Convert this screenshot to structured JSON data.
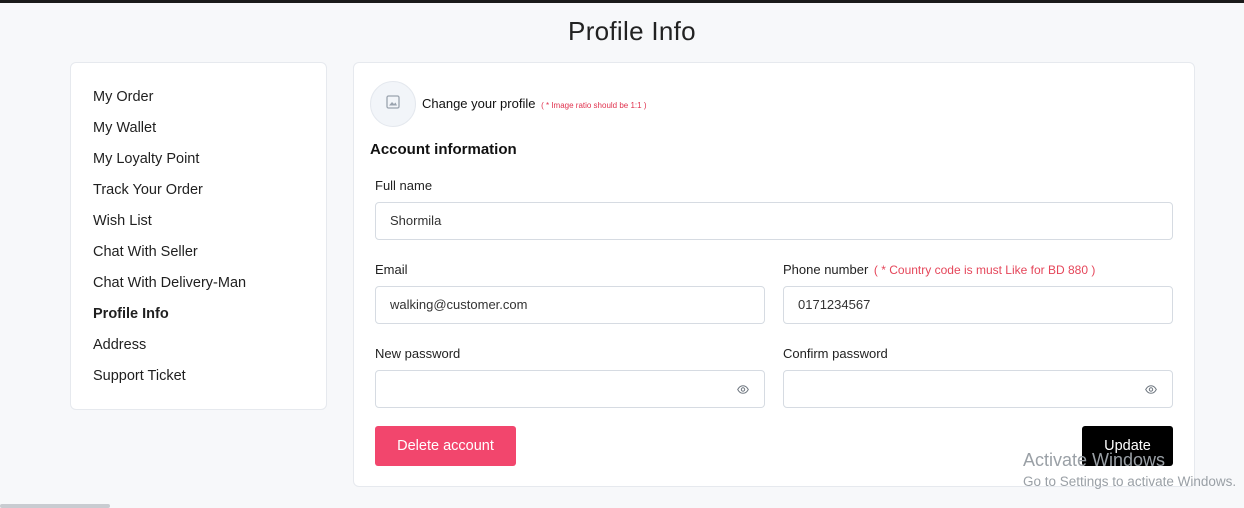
{
  "page": {
    "title": "Profile Info"
  },
  "sidebar": {
    "items": [
      {
        "label": "My Order"
      },
      {
        "label": "My Wallet"
      },
      {
        "label": "My Loyalty Point"
      },
      {
        "label": "Track Your Order"
      },
      {
        "label": "Wish List"
      },
      {
        "label": "Chat With Seller"
      },
      {
        "label": "Chat With Delivery-Man"
      },
      {
        "label": "Profile Info",
        "active": true
      },
      {
        "label": "Address"
      },
      {
        "label": "Support Ticket"
      }
    ]
  },
  "profile": {
    "change_label": "Change your profile",
    "ratio_hint": "( * Image ratio should be 1:1 )",
    "avatar_icon": "image-placeholder-icon"
  },
  "account": {
    "section_title": "Account information",
    "full_name": {
      "label": "Full name",
      "value": "Shormila"
    },
    "email": {
      "label": "Email",
      "value": "walking@customer.com"
    },
    "phone": {
      "label": "Phone number",
      "note": "( * Country code is must Like for BD 880 )",
      "value": "0171234567"
    },
    "new_password": {
      "label": "New password",
      "value": "",
      "icon": "eye-icon"
    },
    "confirm_password": {
      "label": "Confirm password",
      "value": "",
      "icon": "eye-icon"
    }
  },
  "actions": {
    "delete_label": "Delete account",
    "update_label": "Update"
  },
  "watermark": {
    "title": "Activate Windows",
    "subtitle": "Go to Settings to activate Windows."
  },
  "colors": {
    "delete_button": "#f2466d",
    "update_button": "#000000",
    "required_note": "#e5465a",
    "page_background": "#f7f8fa"
  }
}
